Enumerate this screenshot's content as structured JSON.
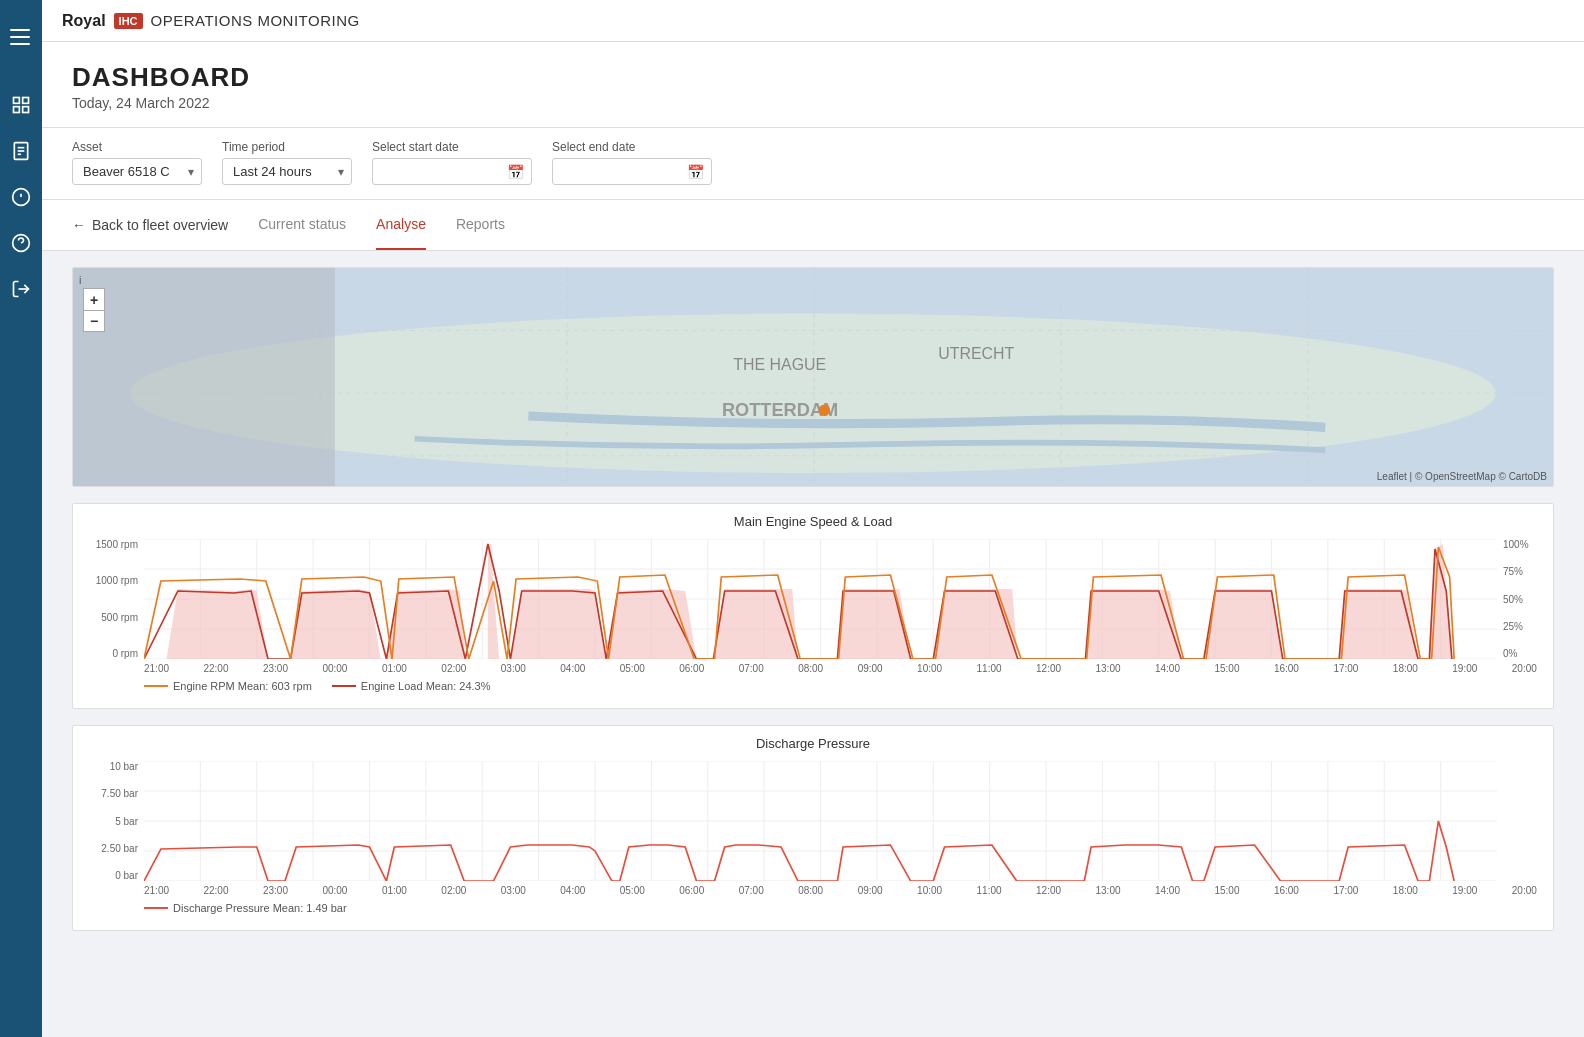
{
  "topbar": {
    "brand": "Royal",
    "ihc_badge": "IHC",
    "app_name": "OPERATIONS MONITORING"
  },
  "dashboard": {
    "title": "DASHBOARD",
    "date": "Today, 24 March 2022"
  },
  "filters": {
    "asset_label": "Asset",
    "asset_value": "Beaver 6518 C",
    "time_period_label": "Time period",
    "time_period_value": "Last 24 hours",
    "start_date_label": "Select start date",
    "start_date_placeholder": "",
    "end_date_label": "Select end date",
    "end_date_placeholder": ""
  },
  "tabs": {
    "back_label": "Back to fleet overview",
    "items": [
      {
        "id": "current-status",
        "label": "Current status",
        "active": false
      },
      {
        "id": "analyse",
        "label": "Analyse",
        "active": true
      },
      {
        "id": "reports",
        "label": "Reports",
        "active": false
      }
    ]
  },
  "chart1": {
    "title": "Main Engine Speed & Load",
    "y_axis_left": [
      "1500 rpm",
      "1000 rpm",
      "500 rpm",
      "0 rpm"
    ],
    "y_axis_right": [
      "100%",
      "75%",
      "50%",
      "25%",
      "0%"
    ],
    "x_axis": [
      "21:00",
      "22:00",
      "23:00",
      "00:00",
      "01:00",
      "02:00",
      "03:00",
      "04:00",
      "05:00",
      "06:00",
      "07:00",
      "08:00",
      "09:00",
      "10:00",
      "11:00",
      "12:00",
      "13:00",
      "14:00",
      "15:00",
      "16:00",
      "17:00",
      "18:00",
      "19:00",
      "20:00"
    ],
    "legend": [
      {
        "label": "Engine RPM  Mean: 603 rpm",
        "color": "#e67e22",
        "style": "dashed"
      },
      {
        "label": "Engine Load  Mean: 24.3%",
        "color": "#c0392b",
        "style": "solid"
      }
    ]
  },
  "chart2": {
    "title": "Discharge Pressure",
    "y_axis_left": [
      "10 bar",
      "7.50 bar",
      "5 bar",
      "2.50 bar",
      "0 bar"
    ],
    "x_axis": [
      "21:00",
      "22:00",
      "23:00",
      "00:00",
      "01:00",
      "02:00",
      "03:00",
      "04:00",
      "05:00",
      "06:00",
      "07:00",
      "08:00",
      "09:00",
      "10:00",
      "11:00",
      "12:00",
      "13:00",
      "14:00",
      "15:00",
      "16:00",
      "17:00",
      "18:00",
      "19:00",
      "20:00"
    ],
    "legend": [
      {
        "label": "Discharge Pressure  Mean: 1.49 bar",
        "color": "#e74c3c",
        "style": "solid"
      }
    ]
  },
  "map": {
    "attribution": "Leaflet | © OpenStreetMap © CartoDB"
  },
  "sidebar": {
    "nav_items": [
      {
        "id": "dashboard",
        "icon": "grid"
      },
      {
        "id": "reports",
        "icon": "file"
      },
      {
        "id": "info",
        "icon": "info"
      },
      {
        "id": "help",
        "icon": "help"
      },
      {
        "id": "logout",
        "icon": "logout"
      }
    ]
  }
}
